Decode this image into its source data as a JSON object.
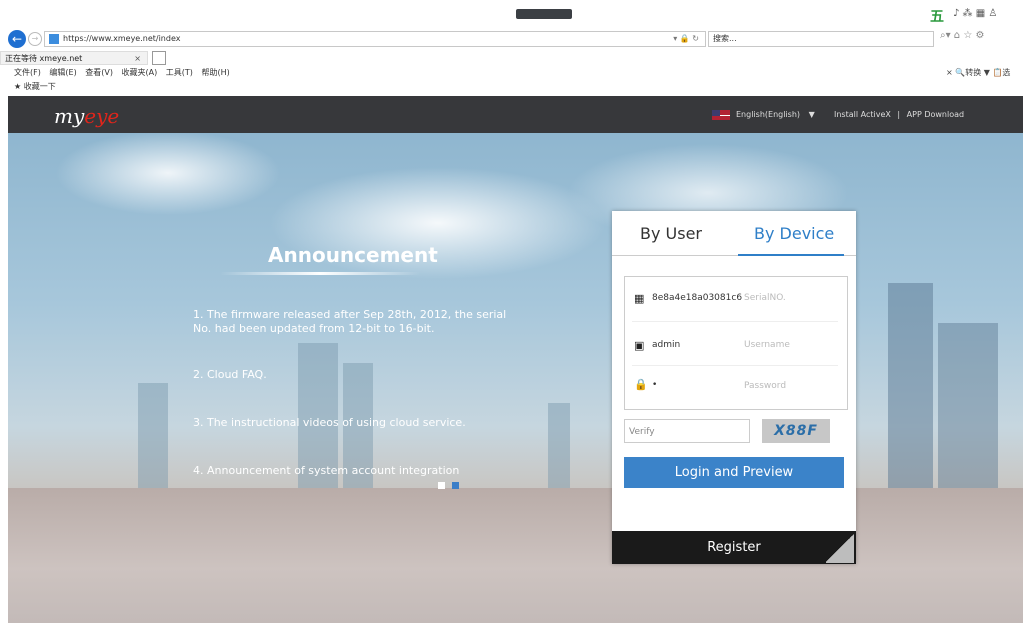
{
  "browser": {
    "url": "https://www.xmeye.net/index",
    "search_placeholder": "搜索...",
    "tab_title": "正在等待 xmeye.net",
    "tab_close": "×",
    "menu": [
      "文件(F)",
      "编辑(E)",
      "查看(V)",
      "收藏夹(A)",
      "工具(T)",
      "帮助(H)"
    ],
    "menu_right": "×  🔍转换 ▼ 📋选",
    "favorites": "收藏一下",
    "sogou_text": "五"
  },
  "site": {
    "logo_main": "my",
    "logo_accent": "eye",
    "language": "English(English)",
    "lang_caret": "▼",
    "install_activex": "Install ActiveX",
    "link_separator": "|",
    "app_download": "APP Download"
  },
  "announcement": {
    "title": "Announcement",
    "items": [
      "1. The firmware released after Sep 28th, 2012, the serial No. had been updated from 12-bit to 16-bit.",
      "2. Cloud FAQ.",
      "3. The instructional videos of using cloud service.",
      "4. Announcement of system account integration"
    ]
  },
  "login": {
    "tab_user": "By User",
    "tab_device": "By Device",
    "serial_value": "8e8a4e18a03081c6",
    "serial_placeholder": "SerialNO.",
    "username_value": "admin",
    "username_placeholder": "Username",
    "password_value": "•",
    "password_placeholder": "Password",
    "verify_placeholder": "Verify",
    "captcha_text": "X88F",
    "login_button": "Login and Preview",
    "register_button": "Register"
  }
}
